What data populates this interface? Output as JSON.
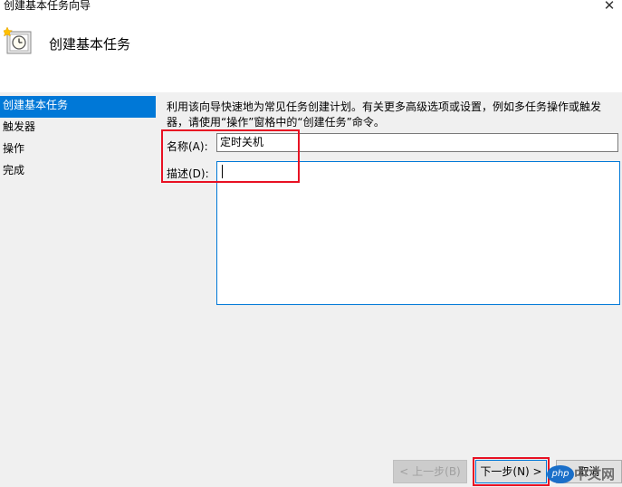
{
  "window": {
    "title": "创建基本任务向导",
    "close_glyph": "✕"
  },
  "header": {
    "title": "创建基本任务",
    "icon": "task-scheduler-clock-icon"
  },
  "sidebar": {
    "items": [
      {
        "label": "创建基本任务",
        "active": true
      },
      {
        "label": "触发器",
        "active": false
      },
      {
        "label": "操作",
        "active": false
      },
      {
        "label": "完成",
        "active": false
      }
    ]
  },
  "main": {
    "intro_text": "利用该向导快速地为常见任务创建计划。有关更多高级选项或设置，例如多任务操作或触发器，请使用“操作”窗格中的“创建任务”命令。",
    "name_label": "名称(A):",
    "name_value": "定时关机",
    "desc_label": "描述(D):",
    "desc_value": ""
  },
  "buttons": {
    "back": "< 上一步(B)",
    "next": "下一步(N) >",
    "cancel": "取消"
  },
  "watermark": {
    "badge": "php",
    "text": "中文网"
  },
  "colors": {
    "accent": "#0078d7",
    "highlight": "#e81123",
    "background": "#f0f0f0"
  }
}
